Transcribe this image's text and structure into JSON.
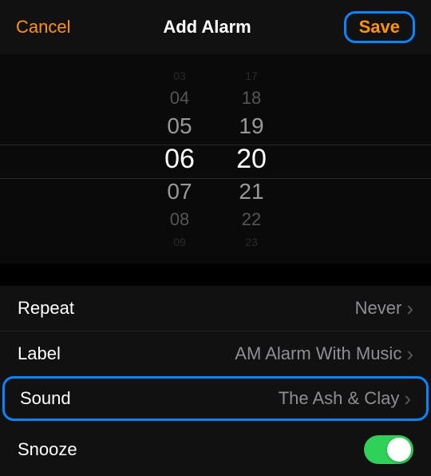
{
  "header": {
    "cancel": "Cancel",
    "title": "Add Alarm",
    "save": "Save"
  },
  "picker": {
    "hours": [
      "03",
      "04",
      "05",
      "06",
      "07",
      "08",
      "09"
    ],
    "minutes": [
      "17",
      "18",
      "19",
      "20",
      "21",
      "22",
      "23"
    ],
    "selectedHour": "06",
    "selectedMinute": "20"
  },
  "rows": {
    "repeat": {
      "label": "Repeat",
      "value": "Never"
    },
    "label": {
      "label": "Label",
      "value": "AM Alarm With Music"
    },
    "sound": {
      "label": "Sound",
      "value": "The Ash & Clay"
    },
    "snooze": {
      "label": "Snooze",
      "on": true
    }
  },
  "colors": {
    "accent": "#ff9500",
    "highlight": "#0a84ff",
    "toggleOn": "#30d158"
  }
}
